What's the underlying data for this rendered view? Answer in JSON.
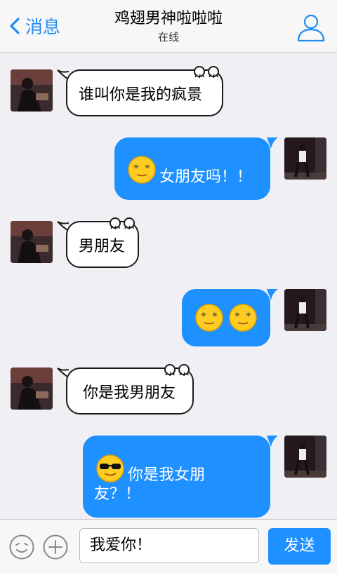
{
  "header": {
    "back_label": "消息",
    "title": "鸡翅男神啦啦啦",
    "status": "在线"
  },
  "messages": [
    {
      "side": "left",
      "text": "谁叫你是我的疯景"
    },
    {
      "side": "right",
      "text": "女朋友吗！！",
      "emoji": "dizzy-face-icon"
    },
    {
      "side": "left",
      "text": "男朋友"
    },
    {
      "side": "right",
      "text": "",
      "emoji": "two-dizzy-faces-icon"
    },
    {
      "side": "left",
      "text": "你是我男朋友"
    },
    {
      "side": "right",
      "text_line1": "你是我女朋",
      "text_line2": "友？！",
      "emoji": "sunglasses-face-icon"
    }
  ],
  "input": {
    "value": "我爱你！",
    "send_label": "发送"
  },
  "colors": {
    "accent": "#1e90ff",
    "background": "#efeff4"
  }
}
